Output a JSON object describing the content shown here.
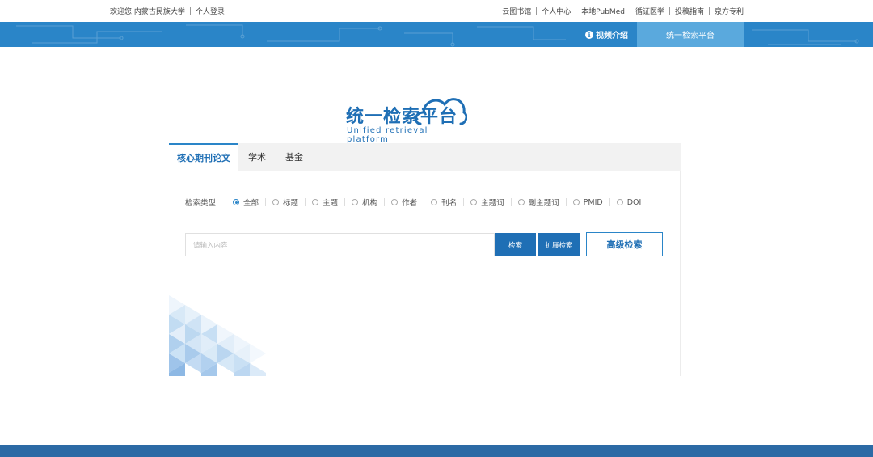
{
  "topbar": {
    "welcome": "欢迎您 内蒙古民族大学",
    "login": "个人登录",
    "links": [
      "云图书馆",
      "个人中心",
      "本地PubMed",
      "循证医学",
      "投稿指南",
      "泉方专利"
    ]
  },
  "nav": {
    "video": "视频介绍",
    "platform": "统一检索平台"
  },
  "logo": {
    "title": "统一检索平台",
    "subtitle": "Unified retrieval platform"
  },
  "tabs": [
    "核心期刊论文",
    "学术",
    "基金"
  ],
  "search_types": {
    "label": "检索类型",
    "options": [
      "全部",
      "标题",
      "主题",
      "机构",
      "作者",
      "刊名",
      "主题词",
      "副主题词",
      "PMID",
      "DOI"
    ],
    "selected": "全部"
  },
  "search": {
    "placeholder": "请输入内容",
    "search_label": "检索",
    "extended_label": "扩展检索",
    "advanced_label": "高级检索"
  },
  "colors": {
    "primary": "#1f6fb5",
    "band": "#2a85c8",
    "active_nav": "#5aa9dd",
    "footer": "#2c6aa5"
  }
}
